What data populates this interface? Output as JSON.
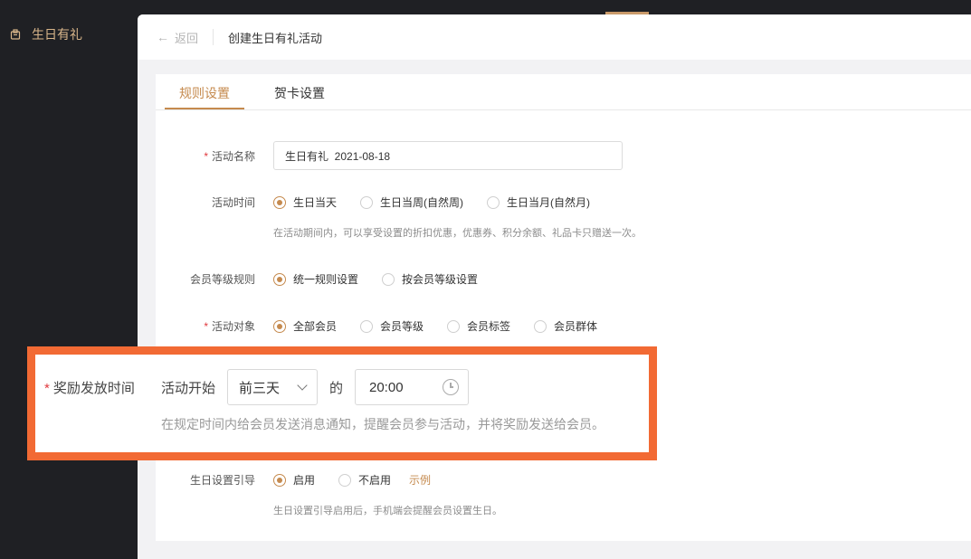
{
  "sidebar": {
    "item_label": "生日有礼",
    "accent_color": "#d8b58a"
  },
  "header": {
    "back_label": "返回",
    "title": "创建生日有礼活动"
  },
  "tabs": [
    {
      "label": "规则设置"
    },
    {
      "label": "贺卡设置"
    }
  ],
  "form": {
    "activity_name": {
      "label": "活动名称",
      "value": "生日有礼  2021-08-18"
    },
    "activity_time": {
      "label": "活动时间",
      "options": [
        "生日当天",
        "生日当周(自然周)",
        "生日当月(自然月)"
      ],
      "hint": "在活动期间内，可以享受设置的折扣优惠，优惠券、积分余额、礼品卡只赠送一次。"
    },
    "member_level_rule": {
      "label": "会员等级规则",
      "options": [
        "统一规则设置",
        "按会员等级设置"
      ]
    },
    "activity_target": {
      "label": "活动对象",
      "options": [
        "全部会员",
        "会员等级",
        "会员标签",
        "会员群体"
      ]
    },
    "reward_time": {
      "label": "奖励发放时间",
      "prefix": "活动开始",
      "select_value": "前三天",
      "connector": "的",
      "time_value": "20:00",
      "hint": "在规定时间内给会员发送消息通知，提醒会员参与活动，并将奖励发送给会员。"
    },
    "birthday_guide": {
      "label": "生日设置引导",
      "options": [
        "启用",
        "不启用"
      ],
      "link": "示例",
      "hint": "生日设置引导启用后，手机端会提醒会员设置生日。"
    }
  },
  "colors": {
    "primary": "#c58a4e",
    "highlight_border": "#f26a34",
    "required": "#e0393e"
  },
  "icons": [
    "gift-icon",
    "arrow-left-icon",
    "chevron-down-icon",
    "clock-icon"
  ]
}
